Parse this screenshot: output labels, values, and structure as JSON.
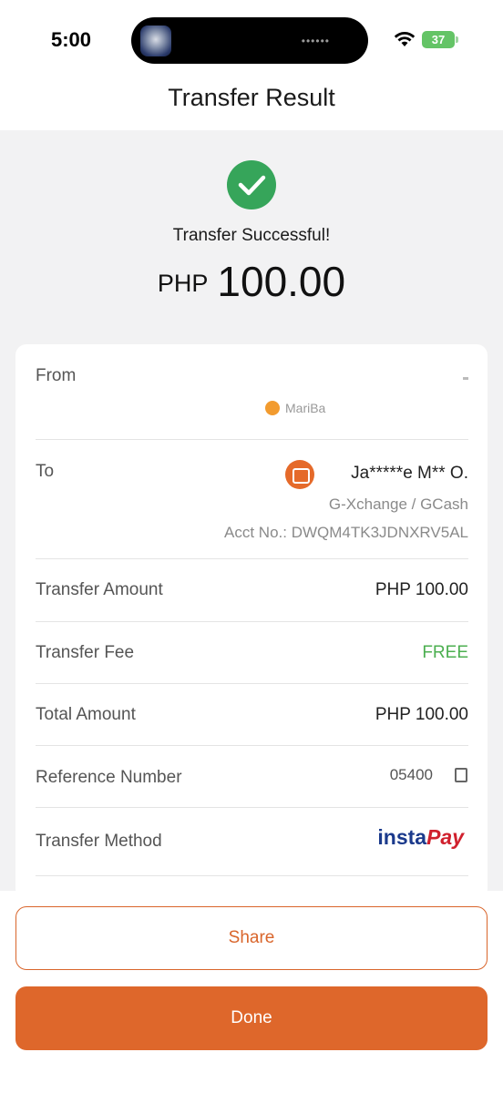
{
  "status_bar": {
    "time": "5:00",
    "battery": "37",
    "island_dots": "••••••"
  },
  "header": {
    "title": "Transfer Result"
  },
  "result": {
    "status_text": "Transfer Successful!",
    "currency": "PHP",
    "amount": "100.00",
    "success_color": "#36a55a"
  },
  "details": {
    "from_label": "From",
    "from_value": "MariBa",
    "to_label": "To",
    "to_name": "Ja*****e M** O.",
    "to_channel": "G-Xchange / GCash",
    "to_account": "Acct No.: DWQM4TK3JDNXRV5AL",
    "transfer_amount_label": "Transfer Amount",
    "transfer_amount_value": "PHP 100.00",
    "transfer_fee_label": "Transfer Fee",
    "transfer_fee_value": "FREE",
    "total_amount_label": "Total Amount",
    "total_amount_value": "PHP 100.00",
    "reference_label": "Reference Number",
    "reference_value": "05400",
    "method_label": "Transfer Method",
    "method_logo_insta": "insta",
    "method_logo_pay": "Pay"
  },
  "actions": {
    "share_label": "Share",
    "done_label": "Done"
  },
  "colors": {
    "accent": "#de672b",
    "free": "#4caf50"
  }
}
